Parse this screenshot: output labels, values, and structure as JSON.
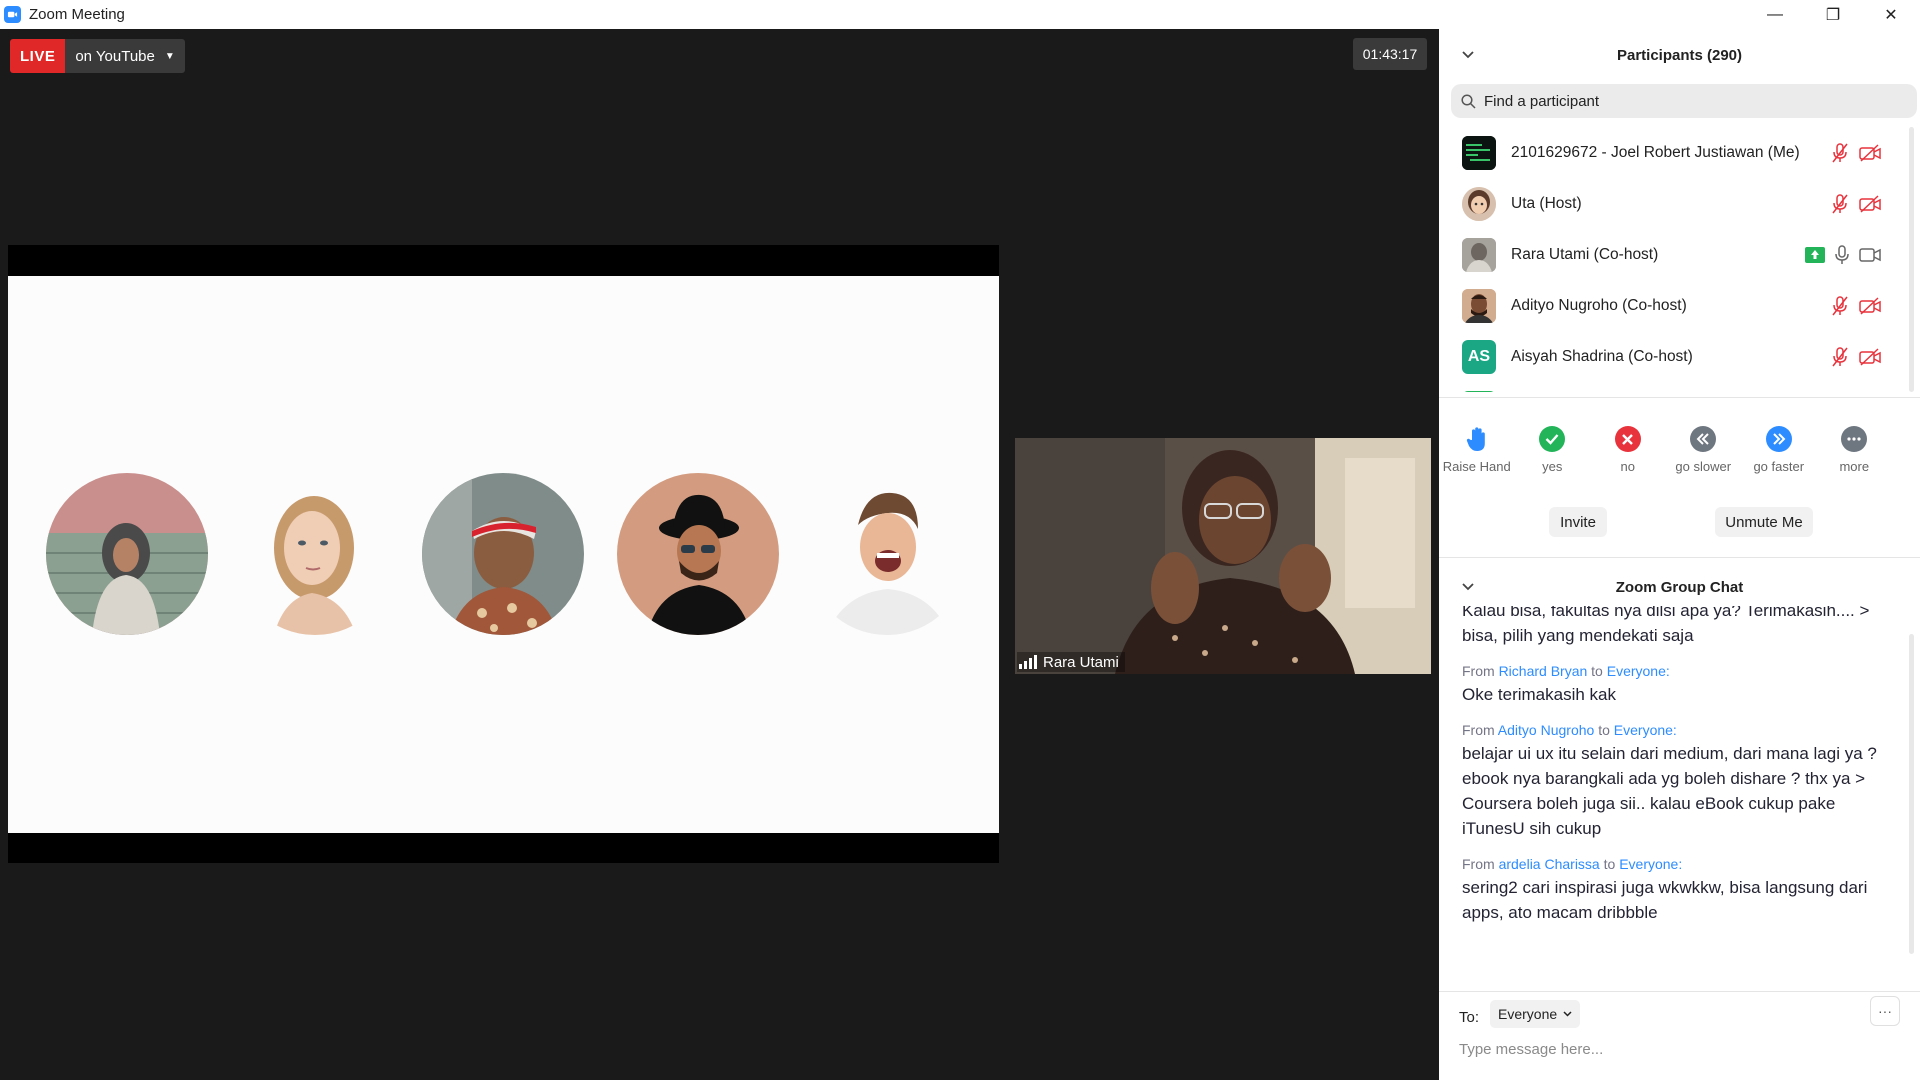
{
  "window": {
    "title": "Zoom Meeting",
    "minimize_glyph": "—",
    "restore_glyph": "❐",
    "close_glyph": "✕"
  },
  "meeting": {
    "live_label": "LIVE",
    "live_target": "on YouTube",
    "timer": "01:43:17",
    "speaker_name": "Rara Utami"
  },
  "participants": {
    "title": "Participants (290)",
    "search_placeholder": "Find a participant",
    "list": [
      {
        "name": "2101629672 - Joel Robert Justiawan (Me)",
        "initials": "",
        "muted": true,
        "video_off": true,
        "sharing": false
      },
      {
        "name": "Uta (Host)",
        "initials": "",
        "muted": true,
        "video_off": true,
        "sharing": false
      },
      {
        "name": "Rara Utami (Co-host)",
        "initials": "",
        "muted": false,
        "video_off": false,
        "sharing": true
      },
      {
        "name": "Adityo Nugroho (Co-host)",
        "initials": "",
        "muted": true,
        "video_off": true,
        "sharing": false
      },
      {
        "name": "Aisyah Shadrina (Co-host)",
        "initials": "AS",
        "muted": true,
        "video_off": true,
        "sharing": false
      }
    ],
    "reactions": [
      {
        "label": "Raise Hand",
        "icon": "raise-hand-icon",
        "color": "#2d8cff"
      },
      {
        "label": "yes",
        "icon": "check-icon",
        "color": "#23b45a"
      },
      {
        "label": "no",
        "icon": "x-icon",
        "color": "#e8323c"
      },
      {
        "label": "go slower",
        "icon": "rewind-icon",
        "color": "#6e7680"
      },
      {
        "label": "go faster",
        "icon": "fast-forward-icon",
        "color": "#2d8cff"
      },
      {
        "label": "more",
        "icon": "more-icon",
        "color": "#6e7680"
      }
    ],
    "invite_label": "Invite",
    "unmute_label": "Unmute Me"
  },
  "chat": {
    "title": "Zoom Group Chat",
    "messages": [
      {
        "from": "",
        "to": "",
        "text": "Kalau bisa, fakultas nya dilsi apa ya? Terimakasih.... > bisa, pilih yang mendekati saja"
      },
      {
        "from": "Richard Bryan",
        "to": "Everyone:",
        "text": "Oke terimakasih kak"
      },
      {
        "from": "Adityo Nugroho",
        "to": "Everyone:",
        "text": "belajar ui ux itu selain dari medium, dari mana lagi ya ? ebook nya barangkali ada yg boleh dishare ? thx ya > Coursera boleh juga sii.. kalau eBook cukup pake iTunesU sih cukup"
      },
      {
        "from": "ardelia Charissa",
        "to": "Everyone:",
        "text": "sering2 cari inspirasi juga wkwkkw, bisa langsung dari apps, ato macam dribbble"
      }
    ],
    "from_word": "From",
    "to_word": "to",
    "to_label": "To:",
    "recipient": "Everyone",
    "input_placeholder": "Type message here...",
    "more_glyph": "···"
  },
  "colors": {
    "accent": "#2d8cff",
    "live_red": "#e02828",
    "mute_red": "#e8323c",
    "share_green": "#23b45a",
    "aisyah_avatar": "#1ba784"
  }
}
